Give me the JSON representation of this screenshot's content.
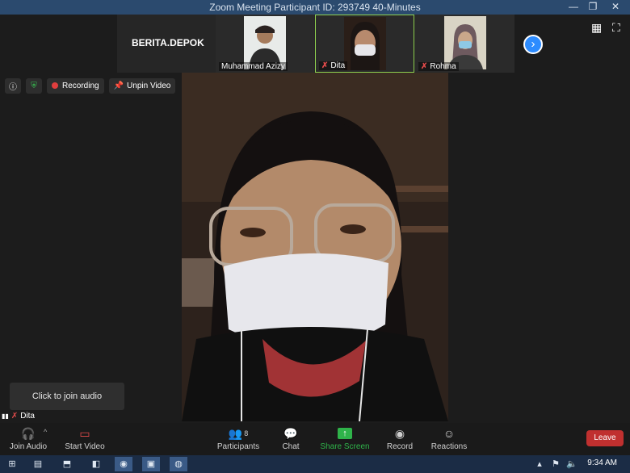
{
  "window": {
    "title": "Zoom Meeting Participant ID: 293749   40-Minutes",
    "minimize": "—",
    "restore": "❐",
    "close": "✕"
  },
  "strip": {
    "channel_label": "BERITA.DEPOK",
    "participants": [
      {
        "name": "Muhammad Azizy",
        "muted": false
      },
      {
        "name": "Dita",
        "muted": true
      },
      {
        "name": "Rohma",
        "muted": true
      }
    ]
  },
  "info": {
    "recording": "Recording",
    "unpin": "Unpin Video"
  },
  "audio_prompt": "Click to join audio",
  "self_name": "Dita",
  "toolbar": {
    "join_audio": "Join Audio",
    "start_video": "Start Video",
    "participants": "Participants",
    "participants_count": "8",
    "chat": "Chat",
    "share_screen": "Share Screen",
    "record": "Record",
    "reactions": "Reactions",
    "leave": "Leave"
  },
  "taskbar": {
    "time": "9:34 AM"
  },
  "colors": {
    "accent": "#2d8cff",
    "share_green": "#2fb34a",
    "leave_red": "#c0302f",
    "mute_red": "#e24b4b"
  }
}
